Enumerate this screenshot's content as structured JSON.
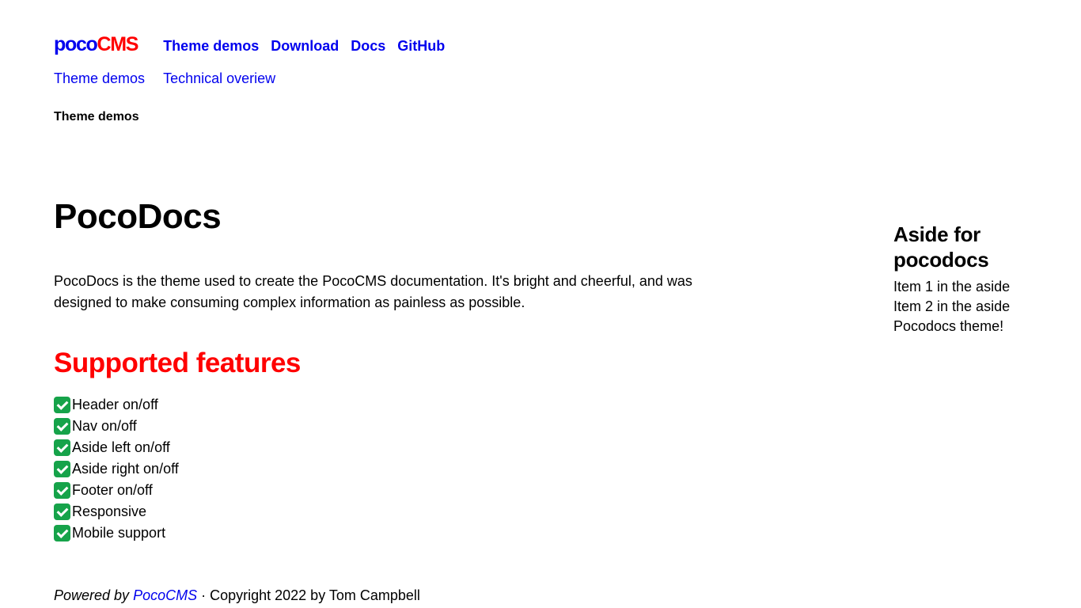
{
  "header": {
    "logo": {
      "part_a": "poco",
      "part_b": "CMS"
    },
    "nav": [
      {
        "label": "Theme demos"
      },
      {
        "label": "Download"
      },
      {
        "label": "Docs"
      },
      {
        "label": "GitHub"
      }
    ]
  },
  "subnav": [
    {
      "label": "Theme demos"
    },
    {
      "label": "Technical overiew"
    }
  ],
  "breadcrumb": "Theme demos",
  "main": {
    "title": "PocoDocs",
    "intro": "PocoDocs is the theme used to create the PocoCMS documentation. It's bright and cheerful, and was designed to make consuming complex information as painless as possible.",
    "features_heading": "Supported features",
    "features": [
      "Header on/off",
      "Nav on/off",
      "Aside left on/off",
      "Aside right on/off",
      "Footer on/off",
      "Responsive",
      "Mobile support"
    ]
  },
  "aside": {
    "title": "Aside for pocodocs",
    "items": [
      "Item 1 in the aside",
      "Item 2 in the aside",
      "Pocodocs theme!"
    ]
  },
  "footer": {
    "powered_by": "Powered by",
    "link": "PocoCMS",
    "copyright": " · Copyright 2022 by Tom Campbell"
  },
  "colors": {
    "link": "#0000ee",
    "accent": "#ff0000",
    "check": "#16a34a"
  },
  "icons": {
    "feature_check": "check-mark-button-icon"
  }
}
